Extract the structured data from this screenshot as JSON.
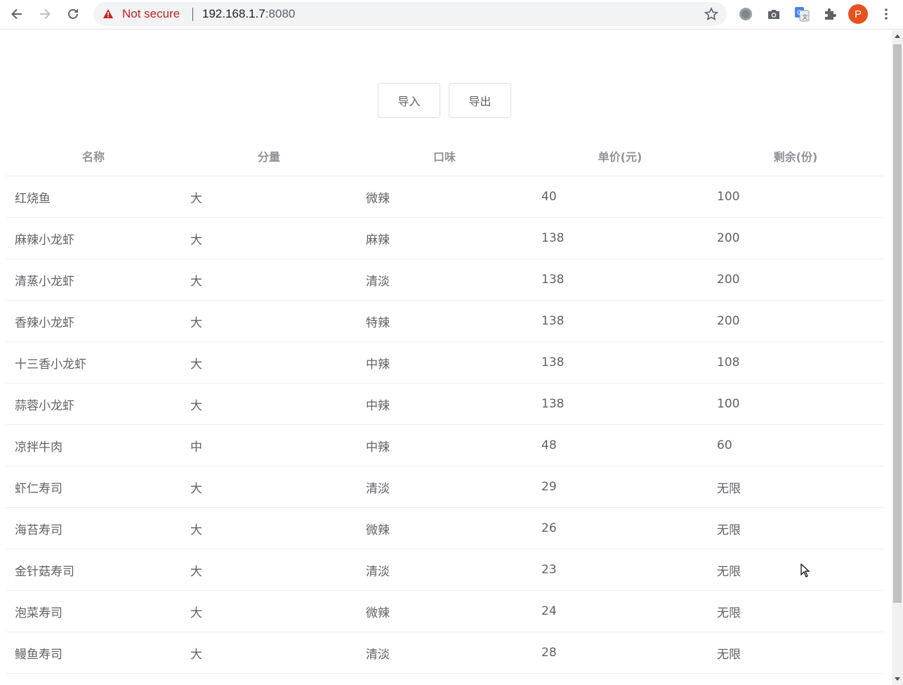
{
  "browser": {
    "security_label": "Not secure",
    "url_host": "192.168.1.7",
    "url_port": ":8080",
    "profile_initial": "P",
    "accent_warning": "#c5221f",
    "profile_color": "#e8501f"
  },
  "actions": {
    "import_label": "导入",
    "export_label": "导出"
  },
  "table": {
    "headers": [
      "名称",
      "分量",
      "口味",
      "单价(元)",
      "剩余(份)"
    ],
    "rows": [
      [
        "红烧鱼",
        "大",
        "微辣",
        "40",
        "100"
      ],
      [
        "麻辣小龙虾",
        "大",
        "麻辣",
        "138",
        "200"
      ],
      [
        "清蒸小龙虾",
        "大",
        "清淡",
        "138",
        "200"
      ],
      [
        "香辣小龙虾",
        "大",
        "特辣",
        "138",
        "200"
      ],
      [
        "十三香小龙虾",
        "大",
        "中辣",
        "138",
        "108"
      ],
      [
        "蒜蓉小龙虾",
        "大",
        "中辣",
        "138",
        "100"
      ],
      [
        "凉拌牛肉",
        "中",
        "中辣",
        "48",
        "60"
      ],
      [
        "虾仁寿司",
        "大",
        "清淡",
        "29",
        "无限"
      ],
      [
        "海苔寿司",
        "大",
        "微辣",
        "26",
        "无限"
      ],
      [
        "金针菇寿司",
        "大",
        "清淡",
        "23",
        "无限"
      ],
      [
        "泡菜寿司",
        "大",
        "微辣",
        "24",
        "无限"
      ],
      [
        "鳗鱼寿司",
        "大",
        "清淡",
        "28",
        "无限"
      ]
    ]
  }
}
